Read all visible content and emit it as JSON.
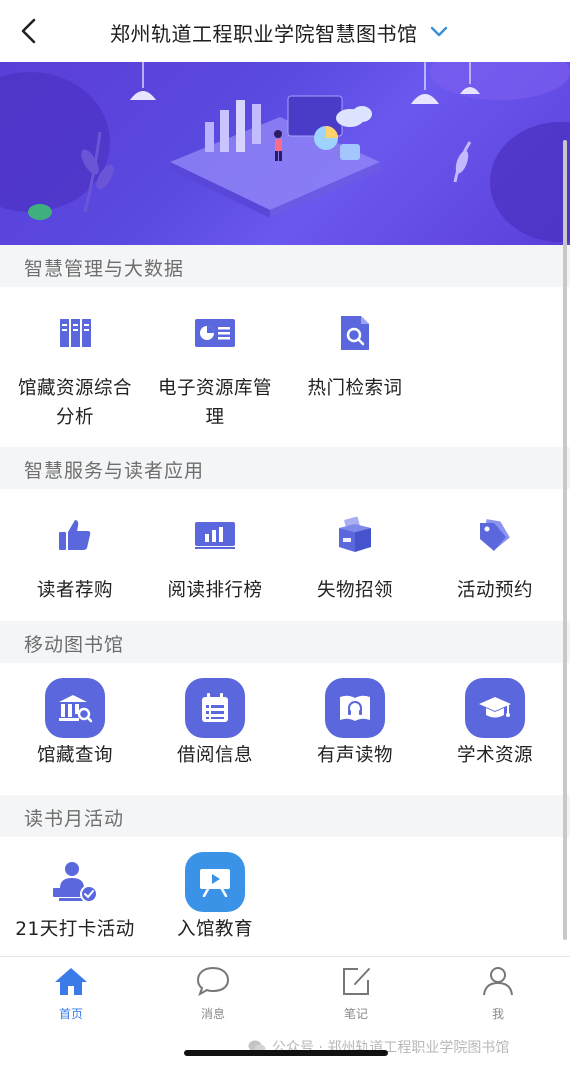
{
  "header": {
    "title": "郑州轨道工程职业学院智慧图书馆"
  },
  "sections": [
    {
      "title": "智慧管理与大数据",
      "items": [
        {
          "label_lines": [
            "馆藏资源综合",
            "分析"
          ],
          "icon": "books-icon"
        },
        {
          "label_lines": [
            "电子资源库管",
            "理"
          ],
          "icon": "chart-card-icon"
        },
        {
          "label_lines": [
            "热门检索词"
          ],
          "icon": "search-doc-icon"
        }
      ]
    },
    {
      "title": "智慧服务与读者应用",
      "items": [
        {
          "label_lines": [
            "读者荐购"
          ],
          "icon": "thumbs-up-icon"
        },
        {
          "label_lines": [
            "阅读排行榜"
          ],
          "icon": "bar-chart-icon"
        },
        {
          "label_lines": [
            "失物招领"
          ],
          "icon": "box-icon"
        },
        {
          "label_lines": [
            "活动预约"
          ],
          "icon": "tags-icon"
        }
      ]
    },
    {
      "title": "移动图书馆",
      "items": [
        {
          "label_lines": [
            "馆藏查询"
          ],
          "icon": "library-search-icon"
        },
        {
          "label_lines": [
            "借阅信息"
          ],
          "icon": "calendar-list-icon"
        },
        {
          "label_lines": [
            "有声读物"
          ],
          "icon": "audiobook-icon"
        },
        {
          "label_lines": [
            "学术资源"
          ],
          "icon": "graduation-cap-icon"
        }
      ]
    },
    {
      "title": "读书月活动",
      "items": [
        {
          "label_lines": [
            "21天打卡活动"
          ],
          "icon": "person-check-icon"
        },
        {
          "label_lines": [
            "入馆教育"
          ],
          "icon": "video-board-icon"
        }
      ]
    }
  ],
  "tabbar": {
    "tabs": [
      {
        "label": "首页",
        "icon": "home-icon",
        "active": true
      },
      {
        "label": "消息",
        "icon": "message-icon",
        "active": false
      },
      {
        "label": "笔记",
        "icon": "note-edit-icon",
        "active": false
      },
      {
        "label": "我",
        "icon": "person-icon",
        "active": false
      }
    ]
  },
  "watermark": "公众号 · 郑州轨道工程职业学院图书馆",
  "colors": {
    "accent": "#5a67dd",
    "tab_active": "#3b7be8",
    "section_bg": "#f4f5f7"
  }
}
